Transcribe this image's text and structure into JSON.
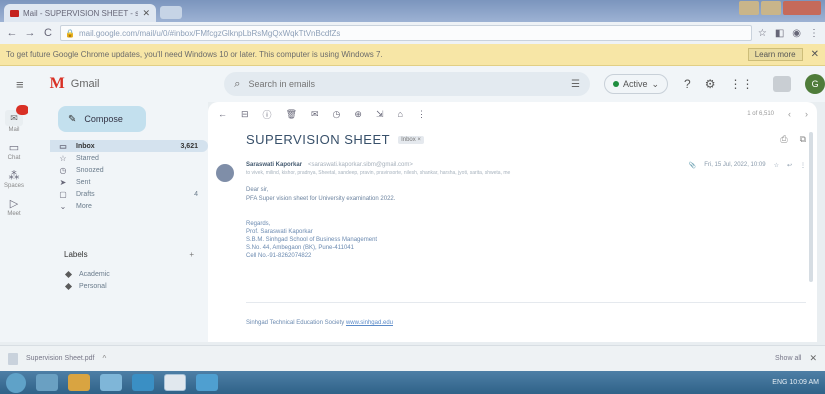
{
  "browser": {
    "tab_title": "Mail - SUPERVISION SHEET - saraswati...",
    "tab_close": "✕",
    "nav": {
      "back": "←",
      "forward": "→",
      "reload": "C"
    },
    "url": "mail.google.com/mail/u/0/#inbox/FMfcgzGlknpLbRsMgQxWqkTtVnBcdfZs",
    "infobar_text": "To get future Google Chrome updates, you'll need Windows 10 or later. This computer is using Windows 7.",
    "infobar_button": "Learn more",
    "infobar_close": "✕"
  },
  "gmail": {
    "hamburger": "≡",
    "logo_m": "M",
    "logo_text": "Gmail",
    "search_placeholder": "Search in emails",
    "status_label": "Active",
    "avatar_initial": "G",
    "rail": [
      {
        "label": "Mail"
      },
      {
        "label": "Chat"
      },
      {
        "label": "Spaces"
      },
      {
        "label": "Meet"
      }
    ],
    "compose_label": "Compose",
    "folders": [
      {
        "label": "Inbox",
        "count": "3,621",
        "active": true,
        "icon": "▭"
      },
      {
        "label": "Starred",
        "count": "",
        "active": false,
        "icon": "☆"
      },
      {
        "label": "Snoozed",
        "count": "",
        "active": false,
        "icon": "◷"
      },
      {
        "label": "Sent",
        "count": "",
        "active": false,
        "icon": "➤"
      },
      {
        "label": "Drafts",
        "count": "4",
        "active": false,
        "icon": "▢"
      },
      {
        "label": "More",
        "count": "",
        "active": false,
        "icon": "⌄"
      }
    ],
    "labels_heading": "Labels",
    "labels_plus": "+",
    "labels": [
      {
        "label": "Academic"
      },
      {
        "label": "Personal"
      }
    ]
  },
  "email": {
    "pager": "1 of 6,510",
    "prev": "‹",
    "next": "›",
    "subject": "SUPERVISION SHEET",
    "inbox_chip": "Inbox ×",
    "sender_name": "Saraswati Kaporkar",
    "sender_email": "<saraswati.kaporkar.sibm@gmail.com>",
    "date": "Fri, 15 Jul, 2022, 10:09",
    "to_line": "to vivek, milind, kishor, pradnya, Sheetal, sandeep, pravin, pravinsorte, nilesh, shankar, harsha, jyoti, sarita, shweta, me",
    "greeting": "Dear sir,",
    "message": "PFA Super vision sheet for University examination 2022.",
    "regards": "Regards,",
    "sig_lines": [
      "Prof. Saraswati Kaporkar",
      "S.B.M. Sinhgad School of Business Management",
      "S.No. 44, Ambegaon (BK), Pune-411041",
      "Cell No.-91-8262074822"
    ],
    "footer_text": "Sinhgad Technical Education Society",
    "footer_link": "www.sinhgad.edu"
  },
  "downloads": {
    "file_name": "Supervision Sheet.pdf",
    "chevron": "^",
    "show_all": "Show all",
    "close": "✕"
  },
  "taskbar": {
    "tray_text": "ENG  10:09 AM"
  }
}
